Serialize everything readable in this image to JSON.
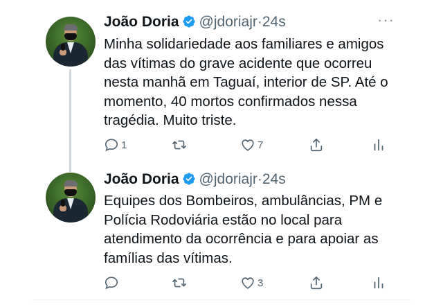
{
  "tweets": [
    {
      "name": "João Doria",
      "handle": "@jdoriajr",
      "dot": "·",
      "time": "24s",
      "more": "···",
      "text": "Minha solidariedade aos familiares e amigos das vítimas do grave acidente que ocorreu nesta manhã em Taguaí, interior de SP. Até o momento, 40 mortos confirmados nessa tragédia. Muito triste.",
      "replies": "1",
      "retweets": "",
      "likes": "7"
    },
    {
      "name": "João Doria",
      "handle": "@jdoriajr",
      "dot": "·",
      "time": "24s",
      "more": "",
      "text": "Equipes dos Bombeiros, ambulâncias, PM e Polícia Rodoviária estão no local para atendimento da ocorrência e para apoiar as famílias das vítimas.",
      "replies": "",
      "retweets": "",
      "likes": "3"
    }
  ],
  "colors": {
    "verified": "#1d9bf0",
    "muted": "#536471",
    "thread_line": "#cfd9de"
  },
  "icons": [
    "verified-badge-icon",
    "reply-icon",
    "retweet-icon",
    "like-icon",
    "share-icon",
    "analytics-icon",
    "more-icon"
  ]
}
